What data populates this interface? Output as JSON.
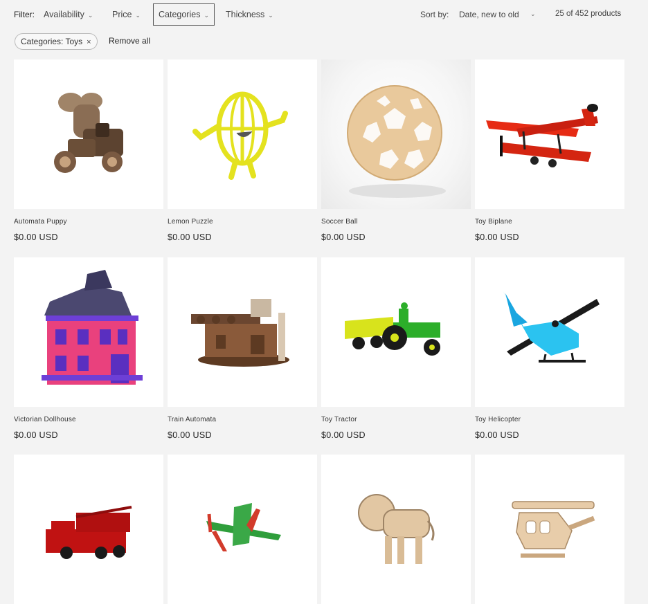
{
  "filter": {
    "label": "Filter:",
    "availability": "Availability",
    "price": "Price",
    "categories": "Categories",
    "thickness": "Thickness"
  },
  "sort": {
    "label": "Sort by:",
    "value": "Date, new to old"
  },
  "count": "25 of 452 products",
  "active_filter": {
    "label": "Categories: Toys",
    "remove_icon": "×"
  },
  "remove_all": "Remove all",
  "products": [
    {
      "title": "Automata Puppy",
      "price": "$0.00 USD"
    },
    {
      "title": "Lemon Puzzle",
      "price": "$0.00 USD"
    },
    {
      "title": "Soccer Ball",
      "price": "$0.00 USD"
    },
    {
      "title": "Toy Biplane",
      "price": "$0.00 USD"
    },
    {
      "title": "Victorian Dollhouse",
      "price": "$0.00 USD"
    },
    {
      "title": "Train Automata",
      "price": "$0.00 USD"
    },
    {
      "title": "Toy Tractor",
      "price": "$0.00 USD"
    },
    {
      "title": "Toy Helicopter",
      "price": "$0.00 USD"
    }
  ],
  "colors": {
    "background": "#f3f3f3",
    "card": "#ffffff",
    "text": "#222222"
  }
}
